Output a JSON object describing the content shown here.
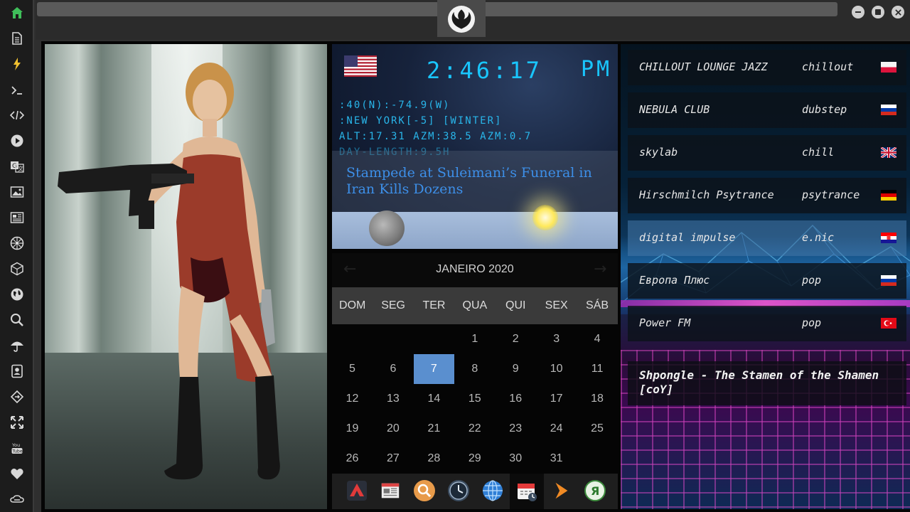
{
  "sidebar": {
    "items": [
      {
        "icon": "home-icon",
        "glyph": "⌂",
        "color": "#3fbf5a"
      },
      {
        "icon": "document-icon",
        "glyph": "🗎"
      },
      {
        "icon": "lightning-icon",
        "glyph": "⚡",
        "color": "#f0c030"
      },
      {
        "icon": "terminal-icon",
        "glyph": ">_"
      },
      {
        "icon": "code-icon",
        "glyph": "</>"
      },
      {
        "icon": "play-icon",
        "glyph": "▶"
      },
      {
        "icon": "translate-icon",
        "glyph": "文"
      },
      {
        "icon": "image-icon",
        "glyph": "▣"
      },
      {
        "icon": "news-icon",
        "glyph": "▤"
      },
      {
        "icon": "rebel-icon",
        "glyph": "✺"
      },
      {
        "icon": "cube-icon",
        "glyph": "⬡"
      },
      {
        "icon": "globe-icon",
        "glyph": "◍"
      },
      {
        "icon": "search-icon",
        "glyph": "⌕"
      },
      {
        "icon": "umbrella-icon",
        "glyph": "☂"
      },
      {
        "icon": "contact-icon",
        "glyph": "▦"
      },
      {
        "icon": "share-icon",
        "glyph": "⇄"
      },
      {
        "icon": "expand-icon",
        "glyph": "✣"
      },
      {
        "icon": "youtube-icon",
        "glyph": "You Tube"
      },
      {
        "icon": "heart-icon",
        "glyph": "♥"
      },
      {
        "icon": "cloud-link-icon",
        "glyph": "∞"
      }
    ]
  },
  "clock": {
    "time": "2:46:17",
    "ampm": "PM",
    "coords": ":40(N):-74.9(W)",
    "location": ":NEW YORK[-5] [WINTER]",
    "astro": "ALT:17.31 AZM:38.5 AZM:0.7",
    "day_length": "DAY-LENGTH:9.5H",
    "headline": "Stampede at Suleimani’s Funeral in Iran Kills Dozens"
  },
  "calendar": {
    "month": "JANEIRO 2020",
    "prev": "←",
    "next": "→",
    "weekdays": [
      "DOM",
      "SEG",
      "TER",
      "QUA",
      "QUI",
      "SEX",
      "SÁB"
    ],
    "weeks": [
      [
        "",
        "",
        "",
        "1",
        "2",
        "3",
        "4"
      ],
      [
        "5",
        "6",
        "7",
        "8",
        "9",
        "10",
        "11"
      ],
      [
        "12",
        "13",
        "14",
        "15",
        "16",
        "17",
        "18"
      ],
      [
        "19",
        "20",
        "21",
        "22",
        "23",
        "24",
        "25"
      ],
      [
        "26",
        "27",
        "28",
        "29",
        "30",
        "31",
        ""
      ]
    ],
    "today": "7",
    "today_color": "#5a8fcf"
  },
  "dock": {
    "items": [
      {
        "icon": "arrow-app-icon"
      },
      {
        "icon": "newspaper-icon"
      },
      {
        "icon": "search-app-icon"
      },
      {
        "icon": "clock-app-icon"
      },
      {
        "icon": "globe-app-icon"
      },
      {
        "icon": "calendar-app-icon"
      },
      {
        "icon": "play-arrow-icon"
      },
      {
        "icon": "yandex-icon",
        "glyph": "Я"
      }
    ]
  },
  "radio": {
    "stations": [
      {
        "name": "CHILLOUT LOUNGE JAZZ",
        "genre": "chillout",
        "flag": "poland"
      },
      {
        "name": "NEBULA CLUB",
        "genre": "dubstep",
        "flag": "russia"
      },
      {
        "name": "skylab",
        "genre": "chill",
        "flag": "uk"
      },
      {
        "name": "Hirschmilch Psytrance",
        "genre": "psytrance",
        "flag": "germany"
      },
      {
        "name": "digital impulse",
        "genre": "e.nic",
        "flag": "croatia"
      },
      {
        "name": "Европа Плюс",
        "genre": "pop",
        "flag": "russia"
      },
      {
        "name": "Power FM",
        "genre": "pop",
        "flag": "turkey"
      }
    ],
    "now_playing": "Shpongle - The Stamen of the Shamen [coY]"
  },
  "colors": {
    "clock_text": "#19c6ff",
    "headline": "#3d8fe8",
    "accent_green": "#3fbf5a"
  }
}
